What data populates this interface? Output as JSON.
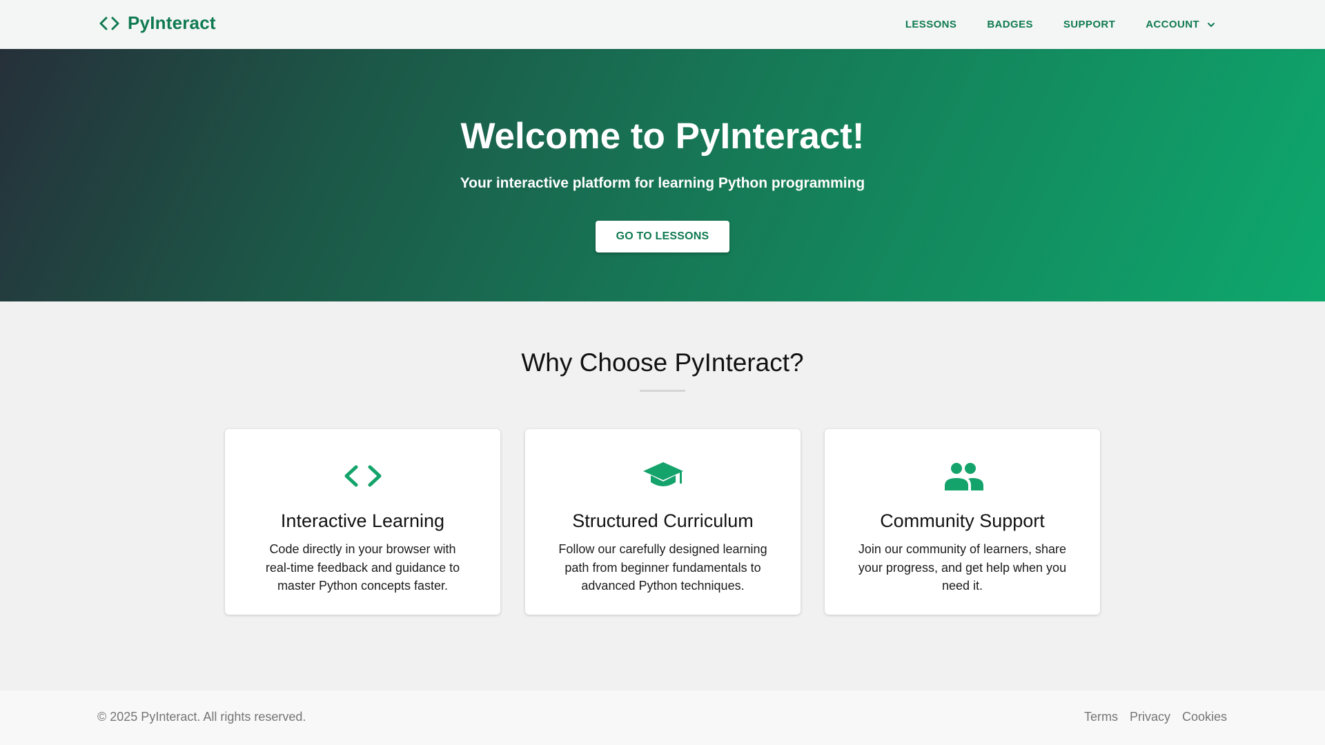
{
  "brand": {
    "name": "PyInteract",
    "icon": "code-icon"
  },
  "nav": {
    "items": [
      {
        "label": "LESSONS"
      },
      {
        "label": "BADGES"
      },
      {
        "label": "SUPPORT"
      },
      {
        "label": "ACCOUNT",
        "icon": "chevron-down-icon"
      }
    ]
  },
  "hero": {
    "title": "Welcome to PyInteract!",
    "subtitle": "Your interactive platform for learning Python programming",
    "button_label": "GO TO LESSONS"
  },
  "features": {
    "title": "Why Choose PyInteract?",
    "cards": [
      {
        "icon": "code-icon",
        "title": "Interactive Learning",
        "text": "Code directly in your browser with real-time feedback and guidance to master Python concepts faster."
      },
      {
        "icon": "graduation-cap-icon",
        "title": "Structured Curriculum",
        "text": "Follow our carefully designed learning path from beginner fundamentals to advanced Python techniques."
      },
      {
        "icon": "people-icon",
        "title": "Community Support",
        "text": "Join our community of learners, share your progress, and get help when you need it."
      }
    ]
  },
  "footer": {
    "copyright": "© 2025 PyInteract. All rights reserved.",
    "links": [
      {
        "label": "Terms"
      },
      {
        "label": "Privacy"
      },
      {
        "label": "Cookies"
      }
    ]
  },
  "colors": {
    "brand_green": "#0f7a51",
    "accent_green": "#14a36b",
    "hero_gradient_start": "#26303a",
    "hero_gradient_end": "#0ea86d"
  }
}
